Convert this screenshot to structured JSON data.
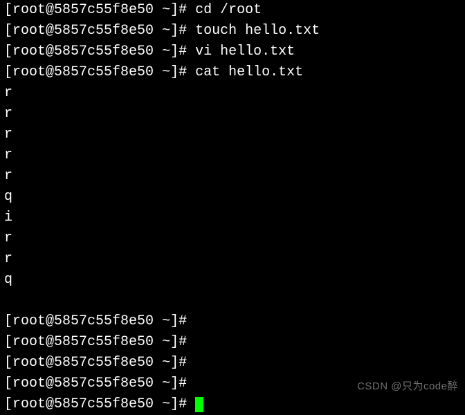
{
  "prompts": {
    "user": "root",
    "host": "5857c55f8e50",
    "path": "~",
    "symbol": "#"
  },
  "lines": [
    {
      "type": "cmd",
      "command": "cd /root",
      "partial": true
    },
    {
      "type": "cmd",
      "command": "touch hello.txt"
    },
    {
      "type": "cmd",
      "command": "vi hello.txt"
    },
    {
      "type": "cmd",
      "command": "cat hello.txt"
    }
  ],
  "output": [
    "r",
    "r",
    "r",
    "r",
    "r",
    "q",
    "i",
    "r",
    "r",
    "q"
  ],
  "empty_prompts": 5,
  "watermark": "CSDN @只为code醉"
}
